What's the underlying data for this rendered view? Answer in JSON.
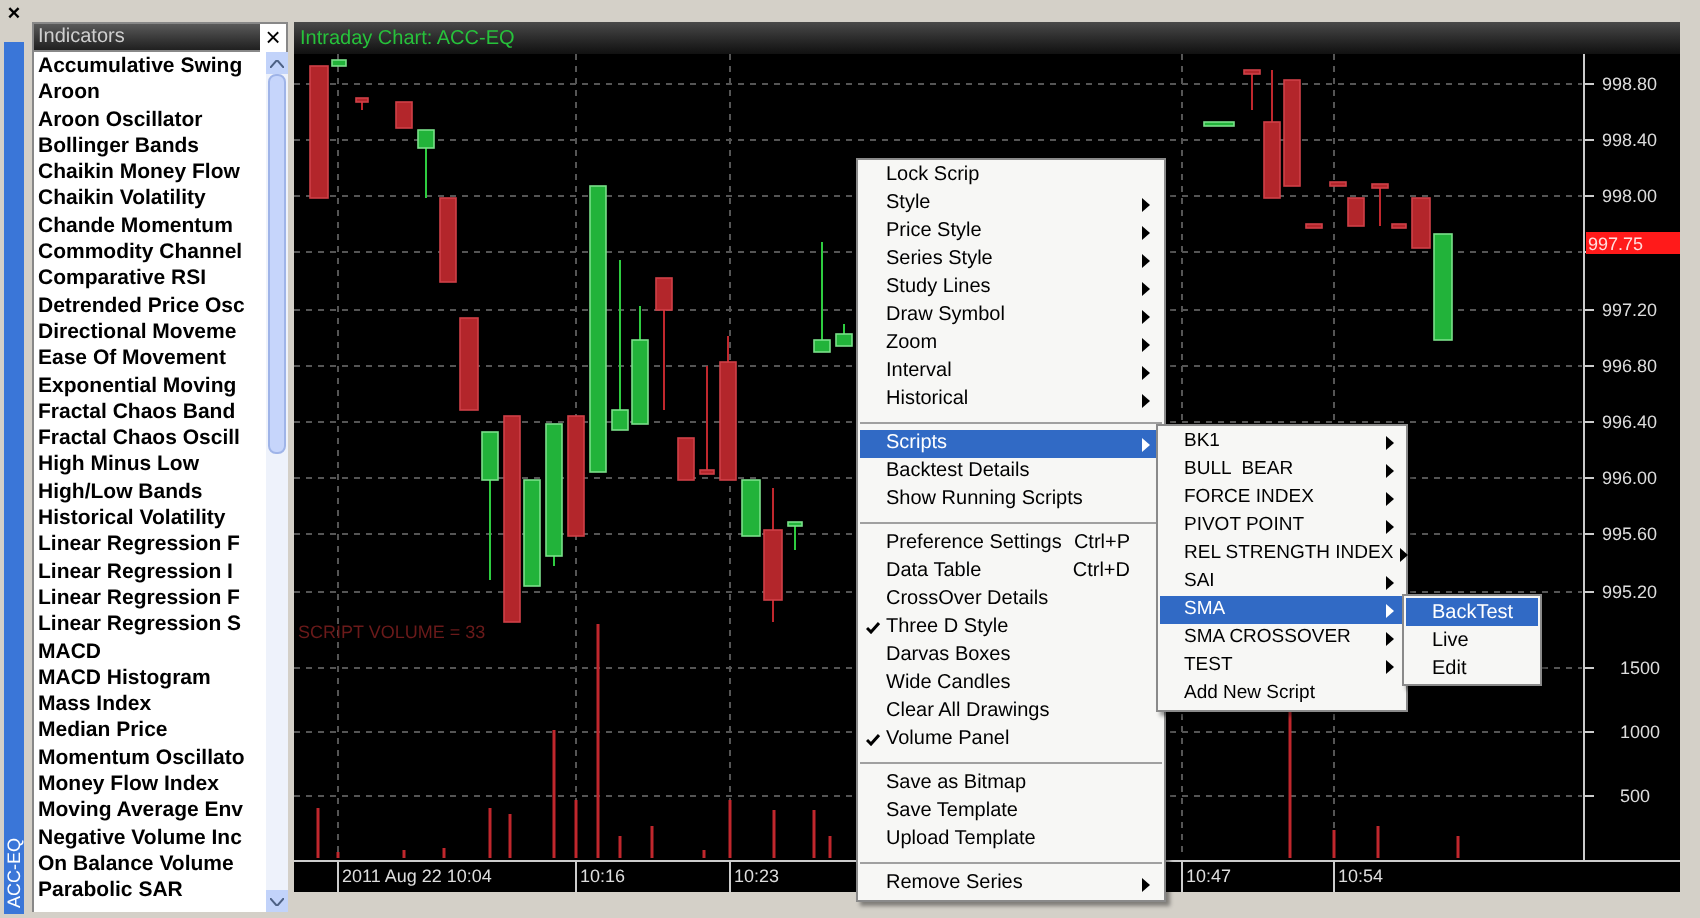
{
  "left_strip": {
    "close": "×",
    "symbol": "ACC-EQ"
  },
  "indicators": {
    "title": "Indicators",
    "close": "×",
    "items": [
      "Accumulative Swing",
      "Aroon",
      "Aroon Oscillator",
      "Bollinger Bands",
      "Chaikin Money Flow",
      "Chaikin Volatility",
      "Chande Momentum",
      "Commodity Channel",
      "Comparative RSI",
      "Detrended Price Osc",
      "Directional Moveme",
      "Ease Of Movement",
      "Exponential Moving",
      "Fractal Chaos Band",
      "Fractal Chaos Oscill",
      "High Minus Low",
      "High/Low Bands",
      "Historical Volatility",
      "Linear Regression F",
      "Linear Regression I",
      "Linear Regression F",
      "Linear Regression S",
      "MACD",
      "MACD Histogram",
      "Mass Index",
      "Median Price",
      "Momentum Oscillato",
      "Money Flow Index",
      "Moving Average Env",
      "Negative Volume Inc",
      "On Balance Volume",
      "Parabolic SAR"
    ]
  },
  "chart": {
    "title": "Intraday Chart: ACC-EQ",
    "price_labels": [
      "998.80",
      "998.40",
      "998.00",
      "997.20",
      "996.80",
      "996.40",
      "996.00",
      "995.60",
      "995.20"
    ],
    "current_price": "997.75",
    "volume_labels": [
      "1500",
      "1000",
      "500"
    ],
    "time_labels": [
      "2011 Aug 22 10:04",
      "10:16",
      "10:23",
      "10:47",
      "10:54"
    ],
    "volume_note": "SCRIPT VOLUME = 33"
  },
  "context_menu": {
    "items": [
      {
        "kind": "item",
        "label": "Lock Scrip",
        "has_submenu": false,
        "checked": false,
        "selected": false
      },
      {
        "kind": "item",
        "label": "Style",
        "has_submenu": true,
        "checked": false,
        "selected": false
      },
      {
        "kind": "item",
        "label": "Price Style",
        "has_submenu": true,
        "checked": false,
        "selected": false
      },
      {
        "kind": "item",
        "label": "Series Style",
        "has_submenu": true,
        "checked": false,
        "selected": false
      },
      {
        "kind": "item",
        "label": "Study Lines",
        "has_submenu": true,
        "checked": false,
        "selected": false
      },
      {
        "kind": "item",
        "label": "Draw Symbol",
        "has_submenu": true,
        "checked": false,
        "selected": false
      },
      {
        "kind": "item",
        "label": "Zoom",
        "has_submenu": true,
        "checked": false,
        "selected": false
      },
      {
        "kind": "item",
        "label": "Interval",
        "has_submenu": true,
        "checked": false,
        "selected": false
      },
      {
        "kind": "item",
        "label": "Historical",
        "has_submenu": true,
        "checked": false,
        "selected": false
      },
      {
        "kind": "separator"
      },
      {
        "kind": "item",
        "label": "Scripts",
        "has_submenu": true,
        "checked": false,
        "selected": true
      },
      {
        "kind": "item",
        "label": "Backtest Details",
        "has_submenu": false,
        "checked": false,
        "selected": false
      },
      {
        "kind": "item",
        "label": "Show Running Scripts",
        "has_submenu": false,
        "checked": false,
        "selected": false
      },
      {
        "kind": "separator"
      },
      {
        "kind": "item",
        "label": "Preference Settings",
        "shortcut": "Ctrl+P",
        "has_submenu": false,
        "checked": false,
        "selected": false
      },
      {
        "kind": "item",
        "label": "Data Table",
        "shortcut": "Ctrl+D",
        "has_submenu": false,
        "checked": false,
        "selected": false
      },
      {
        "kind": "item",
        "label": "CrossOver Details",
        "has_submenu": false,
        "checked": false,
        "selected": false
      },
      {
        "kind": "item",
        "label": "Three D Style",
        "has_submenu": false,
        "checked": true,
        "selected": false
      },
      {
        "kind": "item",
        "label": "Darvas Boxes",
        "has_submenu": false,
        "checked": false,
        "selected": false
      },
      {
        "kind": "item",
        "label": "Wide Candles",
        "has_submenu": false,
        "checked": false,
        "selected": false
      },
      {
        "kind": "item",
        "label": "Clear All Drawings",
        "has_submenu": false,
        "checked": false,
        "selected": false
      },
      {
        "kind": "item",
        "label": "Volume Panel",
        "has_submenu": false,
        "checked": true,
        "selected": false
      },
      {
        "kind": "separator"
      },
      {
        "kind": "item",
        "label": "Save as Bitmap",
        "has_submenu": false,
        "checked": false,
        "selected": false
      },
      {
        "kind": "item",
        "label": "Save Template",
        "has_submenu": false,
        "checked": false,
        "selected": false
      },
      {
        "kind": "item",
        "label": "Upload Template",
        "has_submenu": false,
        "checked": false,
        "selected": false
      },
      {
        "kind": "separator"
      },
      {
        "kind": "item",
        "label": "Remove Series",
        "has_submenu": true,
        "checked": false,
        "selected": false
      }
    ]
  },
  "scripts_menu": {
    "items": [
      {
        "label": "BK1",
        "has_submenu": true,
        "selected": false
      },
      {
        "label": "BULL  BEAR",
        "has_submenu": true,
        "selected": false
      },
      {
        "label": "FORCE INDEX",
        "has_submenu": true,
        "selected": false
      },
      {
        "label": "PIVOT POINT",
        "has_submenu": true,
        "selected": false
      },
      {
        "label": "REL STRENGTH INDEX",
        "has_submenu": true,
        "selected": false
      },
      {
        "label": "SAI",
        "has_submenu": true,
        "selected": false
      },
      {
        "label": "SMA",
        "has_submenu": true,
        "selected": true
      },
      {
        "label": "SMA CROSSOVER",
        "has_submenu": true,
        "selected": false
      },
      {
        "label": "TEST",
        "has_submenu": true,
        "selected": false
      },
      {
        "label": "Add New Script",
        "has_submenu": false,
        "selected": false
      }
    ]
  },
  "sma_menu": {
    "items": [
      {
        "label": "BackTest",
        "selected": true
      },
      {
        "label": "Live",
        "selected": false
      },
      {
        "label": "Edit",
        "selected": false
      }
    ]
  }
}
